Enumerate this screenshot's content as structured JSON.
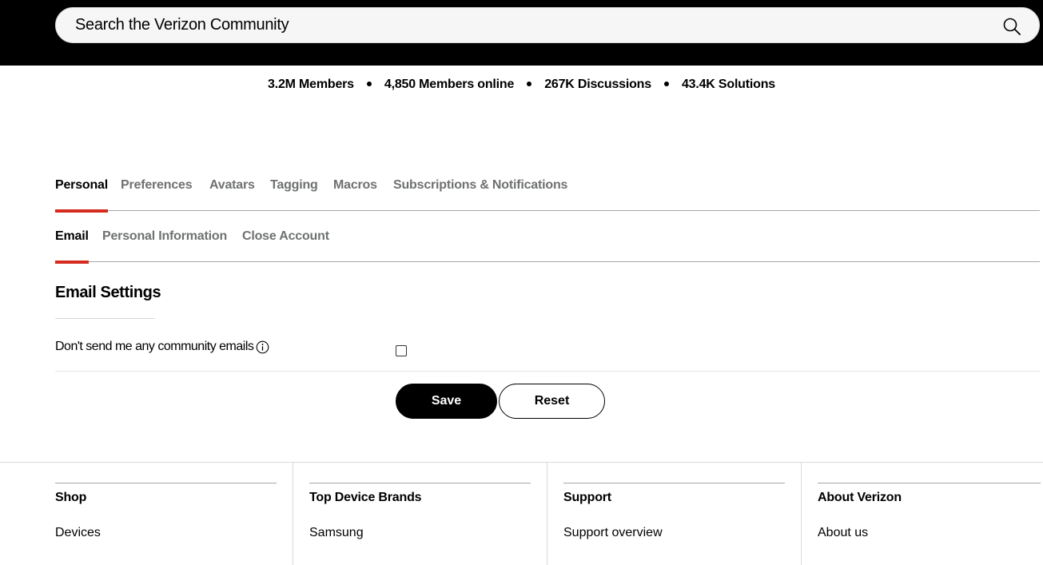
{
  "search": {
    "placeholder": "Search the Verizon Community"
  },
  "stats": {
    "members": "3.2M Members",
    "online": "4,850 Members online",
    "discussions": "267K Discussions",
    "solutions": "43.4K Solutions"
  },
  "tabs": {
    "personal": "Personal",
    "preferences": "Preferences",
    "avatars": "Avatars",
    "tagging": "Tagging",
    "macros": "Macros",
    "subscriptions": "Subscriptions & Notifications"
  },
  "subtabs": {
    "email": "Email",
    "personal_info": "Personal Information",
    "close_account": "Close Account"
  },
  "email_settings": {
    "title": "Email Settings",
    "option_label": "Don't send me any community emails",
    "checked": false
  },
  "buttons": {
    "save": "Save",
    "reset": "Reset"
  },
  "footer": {
    "shop": {
      "heading": "Shop",
      "link1": "Devices"
    },
    "brands": {
      "heading": "Top Device Brands",
      "link1": "Samsung"
    },
    "support": {
      "heading": "Support",
      "link1": "Support overview"
    },
    "about": {
      "heading": "About Verizon",
      "link1": "About us"
    }
  },
  "colors": {
    "accent": "#d52b1e",
    "topbar": "#000000",
    "muted_text": "#6f7171"
  },
  "icons": {
    "search": "search-icon",
    "info": "info-icon"
  }
}
